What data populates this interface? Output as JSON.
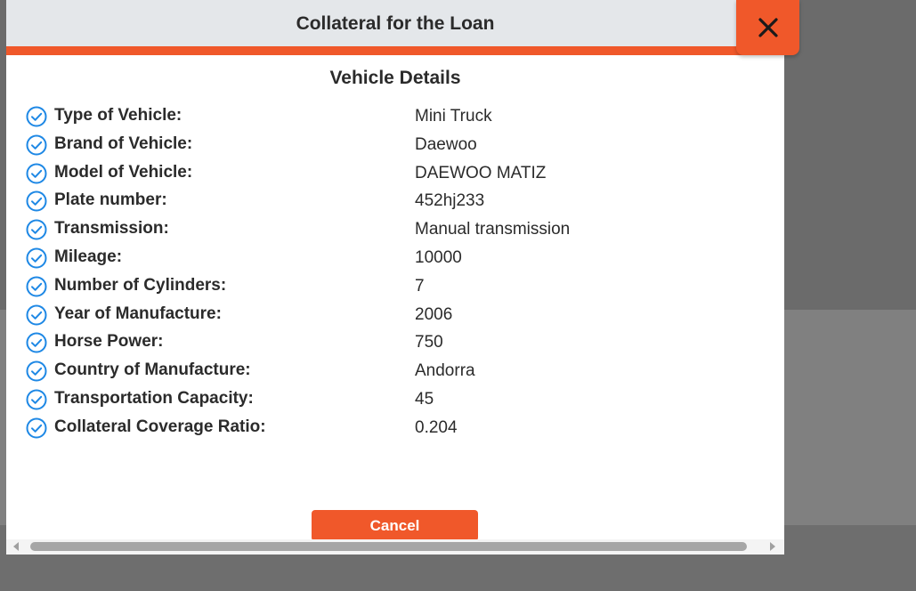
{
  "modal": {
    "title": "Collateral for the Loan",
    "section_title": "Vehicle Details",
    "cancel_label": "Cancel"
  },
  "details": [
    {
      "label": "Type of Vehicle:",
      "value": "Mini Truck"
    },
    {
      "label": "Brand of Vehicle:",
      "value": "Daewoo"
    },
    {
      "label": "Model of Vehicle:",
      "value": "DAEWOO MATIZ"
    },
    {
      "label": "Plate number:",
      "value": "452hj233"
    },
    {
      "label": "Transmission:",
      "value": "Manual transmission"
    },
    {
      "label": "Mileage:",
      "value": "10000"
    },
    {
      "label": "Number of Cylinders:",
      "value": "7"
    },
    {
      "label": "Year of Manufacture:",
      "value": "2006"
    },
    {
      "label": "Horse Power:",
      "value": "750"
    },
    {
      "label": "Country of Manufacture:",
      "value": "Andorra"
    },
    {
      "label": "Transportation Capacity:",
      "value": "45"
    },
    {
      "label": "Collateral Coverage Ratio:",
      "value": "0.204"
    }
  ],
  "icons": {
    "row_icon": "check-circle-icon",
    "close": "close-icon"
  },
  "colors": {
    "accent": "#f0582a",
    "check": "#1e88e5",
    "header_bg": "#e4e7ea"
  }
}
